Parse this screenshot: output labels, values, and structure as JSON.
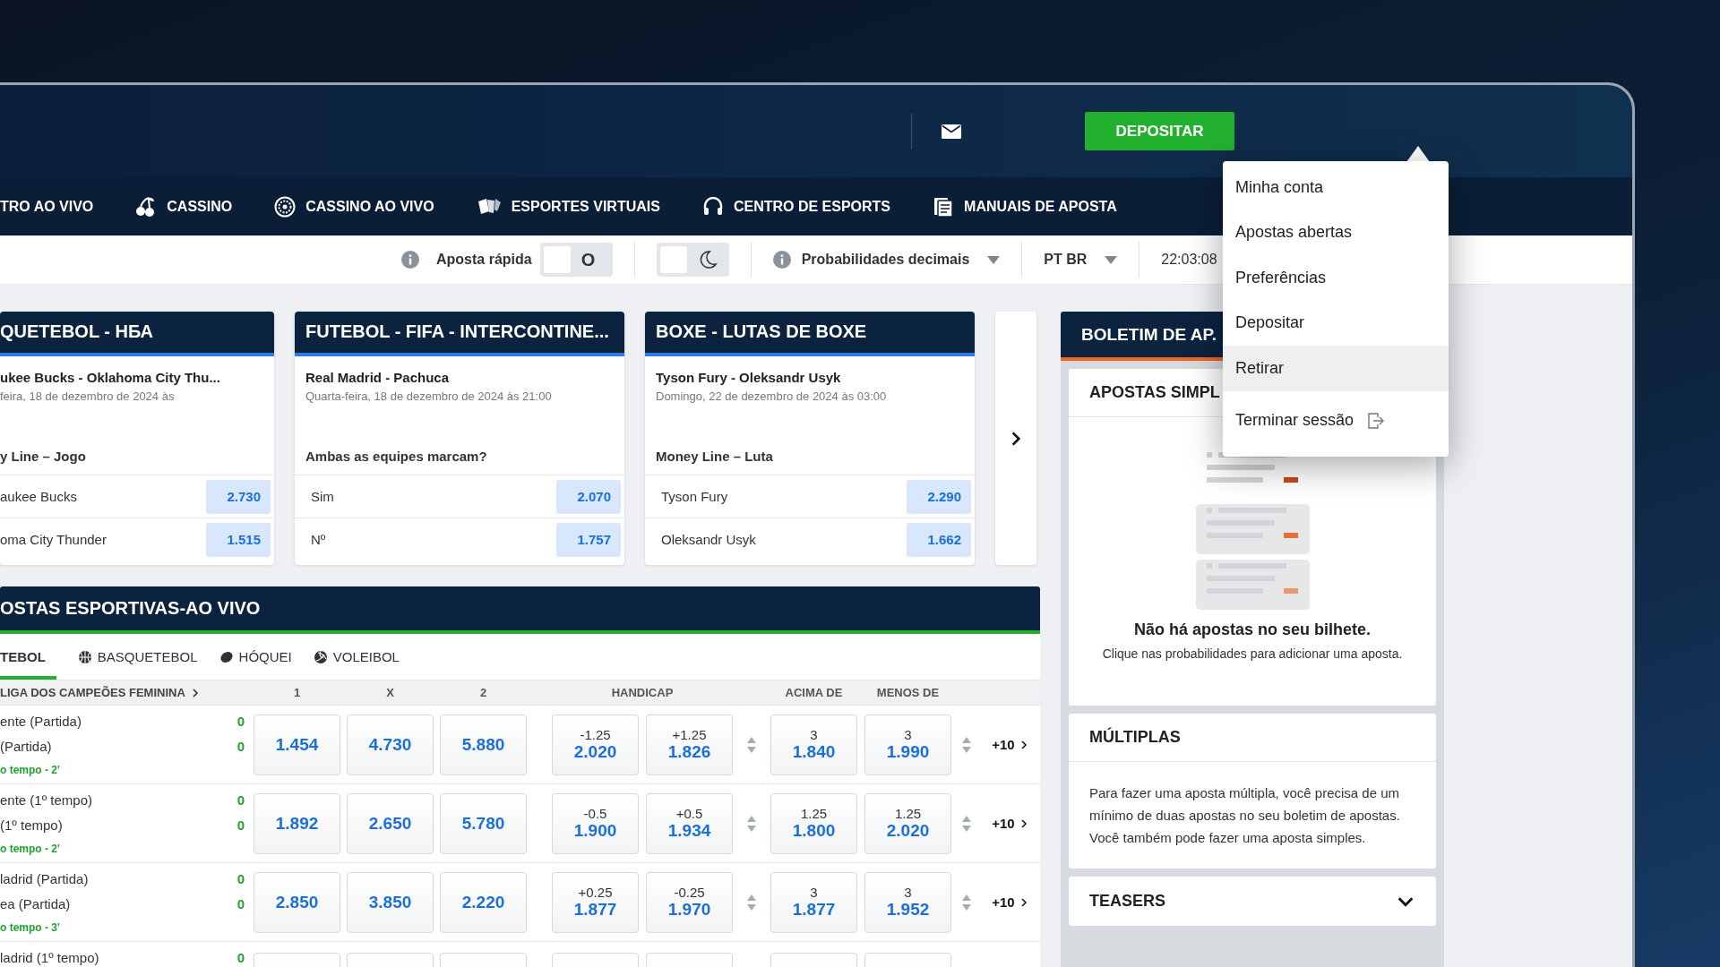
{
  "header": {
    "deposit_button": "DEPOSITAR"
  },
  "nav": [
    {
      "label": "TRO AO VIVO"
    },
    {
      "label": "CASSINO"
    },
    {
      "label": "CASSINO AO VIVO"
    },
    {
      "label": "ESPORTES VIRTUAIS"
    },
    {
      "label": "CENTRO DE ESPORTS"
    },
    {
      "label": "MANUAIS DE APOSTA"
    }
  ],
  "toolbar": {
    "quick_bet": {
      "label": "Aposta rápida",
      "value": "O",
      "on": false
    },
    "dark_mode": {
      "on": false
    },
    "odds_format": "Probabilidades decimais",
    "language": "PT BR",
    "time": "22:03:08"
  },
  "featured_cards": [
    {
      "title": "QUETEBOL - НБА",
      "match": "ukee Bucks - Oklahoma City Thu...",
      "date": "feira, 18 de dezembro de 2024 às",
      "market": "y Line – Jogo",
      "options": [
        {
          "name": "aukee Bucks",
          "odds": "2.730"
        },
        {
          "name": "oma City Thunder",
          "odds": "1.515"
        }
      ]
    },
    {
      "title": "FUTEBOL - FIFA - INTERCONTINE...",
      "match": "Real Madrid - Pachuca",
      "date": "Quarta-feira, 18 de dezembro de 2024 às 21:00",
      "market": "Ambas as equipes marcam?",
      "options": [
        {
          "name": "Sim",
          "odds": "2.070"
        },
        {
          "name": "Nº",
          "odds": "1.757"
        }
      ]
    },
    {
      "title": "BOXE - LUTAS DE BOXE",
      "match": "Tyson Fury - Oleksandr Usyk",
      "date": "Domingo, 22 de dezembro de 2024 às 03:00",
      "market": "Money Line – Luta",
      "options": [
        {
          "name": "Tyson Fury",
          "odds": "2.290"
        },
        {
          "name": "Oleksandr Usyk",
          "odds": "1.662"
        }
      ]
    }
  ],
  "live": {
    "title": "OSTAS ESPORTIVAS-AO VIVO",
    "tabs": [
      {
        "label": "TEBOL",
        "selected": true
      },
      {
        "label": "BASQUETEBOL",
        "selected": false
      },
      {
        "label": "HÓQUEI",
        "selected": false
      },
      {
        "label": "VOLEIBOL",
        "selected": false
      }
    ],
    "league": "LIGA DOS CAMPEÕES FEMININA",
    "columns": [
      "1",
      "X",
      "2",
      "HANDICAP",
      "ACIMA DE",
      "MENOS DE"
    ],
    "rows": [
      {
        "kind": "full",
        "team1": "ente (Partida)",
        "team2": "(Partida)",
        "score1": "0",
        "score2": "0",
        "period": "o tempo - 2'",
        "odds": [
          "1.454",
          "4.730",
          "5.880"
        ],
        "handicap": [
          {
            "line": "-1.25",
            "odds": "2.020"
          },
          {
            "line": "+1.25",
            "odds": "1.826"
          }
        ],
        "totals": [
          {
            "line": "3",
            "odds": "1.840"
          },
          {
            "line": "3",
            "odds": "1.990"
          }
        ],
        "more": "+10"
      },
      {
        "kind": "full",
        "team1": "ente (1º tempo)",
        "team2": "(1º tempo)",
        "score1": "0",
        "score2": "0",
        "period": "o tempo - 2'",
        "odds": [
          "1.892",
          "2.650",
          "5.780"
        ],
        "handicap": [
          {
            "line": "-0.5",
            "odds": "1.900"
          },
          {
            "line": "+0.5",
            "odds": "1.934"
          }
        ],
        "totals": [
          {
            "line": "1.25",
            "odds": "1.800"
          },
          {
            "line": "1.25",
            "odds": "2.020"
          }
        ],
        "more": "+10"
      },
      {
        "kind": "full",
        "team1": "ladrid (Partida)",
        "team2": "ea (Partida)",
        "score1": "0",
        "score2": "0",
        "period": "o tempo - 3'",
        "odds": [
          "2.850",
          "3.850",
          "2.220"
        ],
        "handicap": [
          {
            "line": "+0.25",
            "odds": "1.877"
          },
          {
            "line": "-0.25",
            "odds": "1.970"
          }
        ],
        "totals": [
          {
            "line": "3",
            "odds": "1.877"
          },
          {
            "line": "3",
            "odds": "1.952"
          }
        ],
        "more": "+10"
      },
      {
        "kind": "partial",
        "team1": "ladrid (1º tempo)",
        "score1": "0"
      }
    ]
  },
  "bet_slip": {
    "title": "BOLETIM DE AP.",
    "singles": {
      "title": "APOSTAS SIMPL",
      "empty_title": "Não há apostas no seu bilhete.",
      "empty_text": "Clique nas probabilidades para adicionar uma aposta."
    },
    "multiples": {
      "title": "MÚLTIPLAS",
      "text": "Para fazer uma aposta múltipla, você precisa de um mínimo de duas apostas no seu boletim de apostas. Você também pode fazer uma aposta simples."
    },
    "teasers": {
      "title": "TEASERS",
      "expanded": false
    }
  },
  "user_menu": {
    "items": [
      {
        "label": "Minha conta",
        "kind": "link",
        "selected": false
      },
      {
        "label": "Apostas abertas",
        "kind": "link",
        "selected": false
      },
      {
        "label": "Preferências",
        "kind": "link",
        "selected": false
      },
      {
        "label": "Depositar",
        "kind": "link",
        "selected": false
      },
      {
        "label": "Retirar",
        "kind": "link",
        "selected": true
      },
      {
        "label": "Terminar sessão",
        "kind": "logout",
        "selected": false
      }
    ]
  }
}
